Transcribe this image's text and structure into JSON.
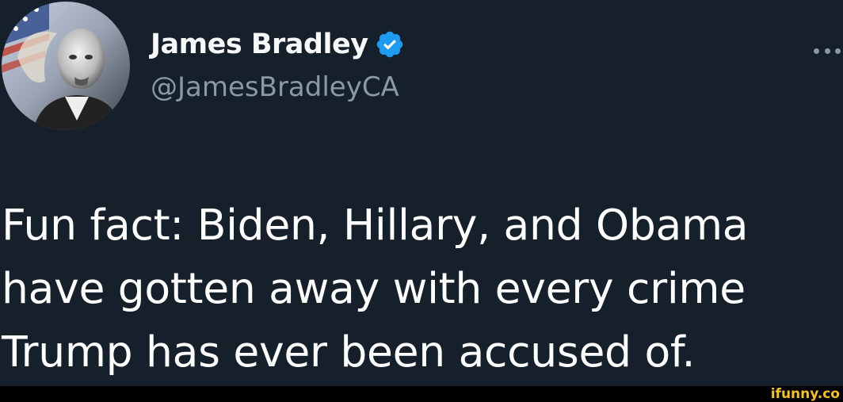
{
  "tweet": {
    "author": {
      "display_name": "James Bradley",
      "handle": "@JamesBradleyCA",
      "verified_icon": "verified-badge-icon"
    },
    "text_lines": [
      "Fun fact: Biden, Hillary, and Obama",
      "have gotten away with every crime",
      "Trump has ever been accused of."
    ],
    "more_icon": "more-options-icon"
  },
  "footer": {
    "watermark": "ifunny.co"
  },
  "colors": {
    "background": "#15202b",
    "handle": "#8b98a5",
    "verified": "#1d9bf0",
    "watermark": "#f6c21b"
  }
}
